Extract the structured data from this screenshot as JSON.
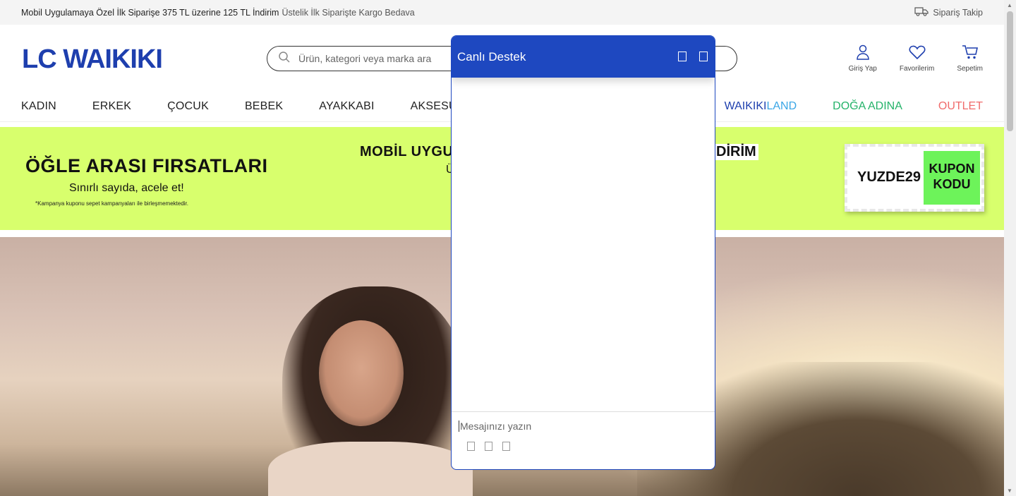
{
  "topbar": {
    "promo_bold": "Mobil Uygulamaya Özel İlk Siparişe 375 TL üzerine 125 TL İndirim",
    "promo_light": "Üstelik İlk Siparişte Kargo Bedava",
    "order_track": "Sipariş Takip"
  },
  "header": {
    "logo": "LC WAIKIKI",
    "search_placeholder": "Ürün, kategori veya marka ara",
    "login": "Giriş Yap",
    "favorites": "Favorilerim",
    "cart": "Sepetim"
  },
  "nav": {
    "items": [
      "KADIN",
      "ERKEK",
      "ÇOCUK",
      "BEBEK",
      "AYAKKABI",
      "AKSESUAR"
    ],
    "waikiki_a": "WAIKIKI",
    "waikiki_b": "LAND",
    "doga": "DOĞA ADINA",
    "outlet": "OUTLET"
  },
  "banner": {
    "title": "ÖĞLE ARASI FIRSATLARI",
    "subtitle": "Sınırlı sayıda, acele et!",
    "note": "*Kampanya kuponu sepet kampanyaları ile birleşmemektedir.",
    "mid_left": "MOBİL UYGU",
    "mid_right": "DİRİM",
    "mid_line2": "Ü",
    "coupon_code": "YUZDE29",
    "coupon_label_1": "KUPON",
    "coupon_label_2": "KODU"
  },
  "chat": {
    "title": "Canlı Destek",
    "input_placeholder": "Mesajınızı yazın"
  },
  "colors": {
    "brand": "#1e3fae",
    "chat_header": "#1e48c0",
    "banner_bg": "#d8ff6d"
  }
}
